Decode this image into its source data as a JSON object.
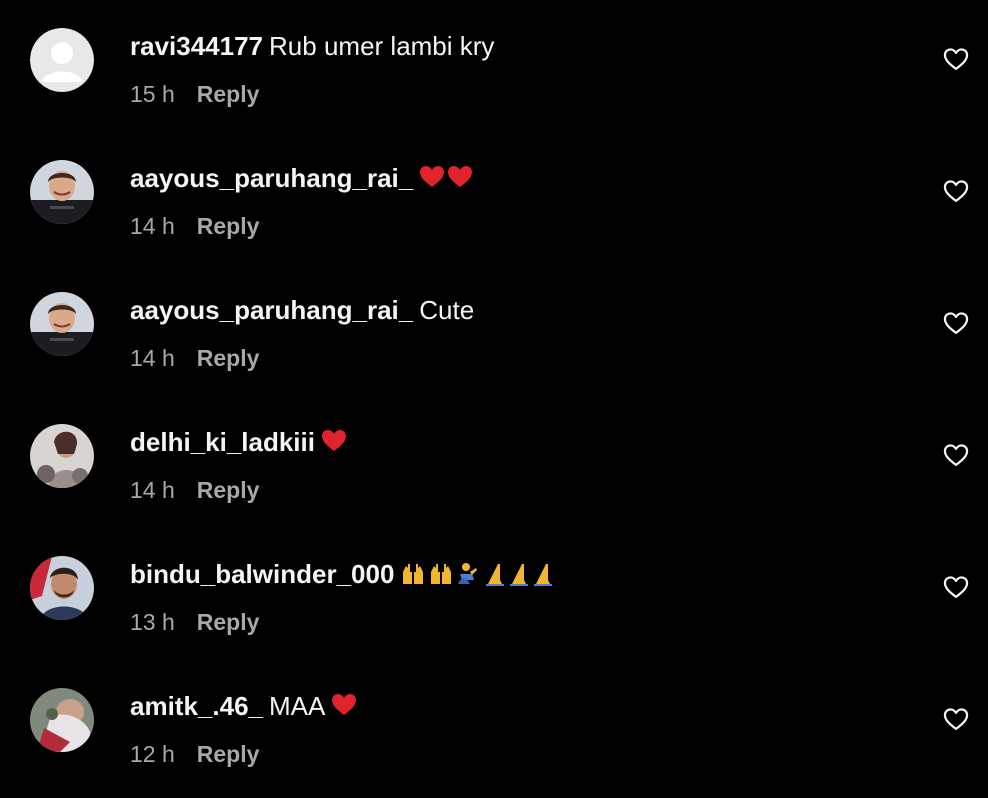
{
  "comments": [
    {
      "username": "ravi344177",
      "text": "Rub umer lambi kry",
      "emoji": "",
      "time": "15 h",
      "reply_label": "Reply",
      "avatar": "default-avatar"
    },
    {
      "username": "aayous_paruhang_rai_",
      "text": "",
      "emoji": "❤️❤️",
      "time": "14 h",
      "reply_label": "Reply",
      "avatar": "photo-avatar"
    },
    {
      "username": "aayous_paruhang_rai_",
      "text": "Cute",
      "emoji": "",
      "time": "14 h",
      "reply_label": "Reply",
      "avatar": "photo-avatar"
    },
    {
      "username": "delhi_ki_ladkiii",
      "text": "",
      "emoji": "❤️",
      "time": "14 h",
      "reply_label": "Reply",
      "avatar": "photo-avatar"
    },
    {
      "username": "bindu_balwinder_000",
      "text": "",
      "emoji": "🙌🙌🧎🙏🙏🙏",
      "time": "13 h",
      "reply_label": "Reply",
      "avatar": "photo-avatar"
    },
    {
      "username": "amitk_.46_",
      "text": "MAA",
      "emoji": "❤️",
      "time": "12 h",
      "reply_label": "Reply",
      "avatar": "photo-avatar"
    }
  ],
  "icons": {
    "like": "heart-outline-icon",
    "heart_emoji_color": "#e0232d"
  },
  "colors": {
    "background": "#000000",
    "primary_text": "#f5f5f5",
    "secondary_text": "#a8a8a8"
  }
}
